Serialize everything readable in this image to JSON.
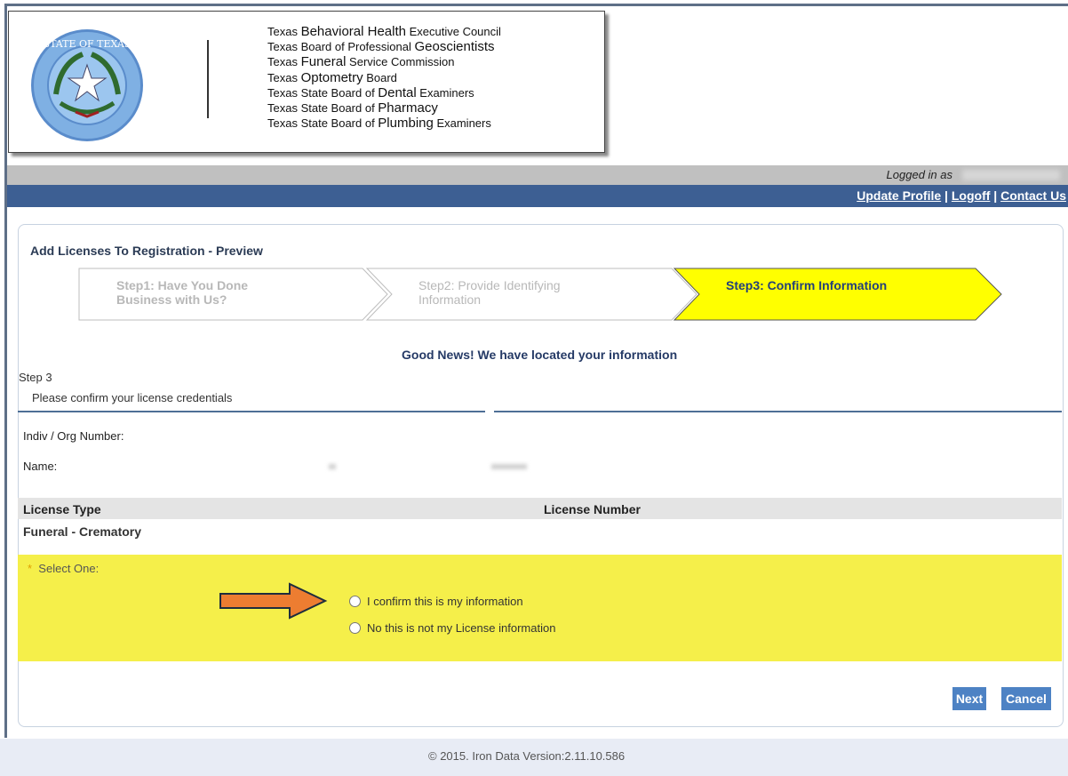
{
  "header": {
    "boards": [
      {
        "pre": "Texas ",
        "big": "Behavioral Health",
        "post": " Executive Council"
      },
      {
        "pre": "Texas Board of Professional ",
        "big": "Geoscientists",
        "post": ""
      },
      {
        "pre": "Texas ",
        "big": "Funeral",
        "post": " Service Commission"
      },
      {
        "pre": "Texas ",
        "big": "Optometry",
        "post": " Board"
      },
      {
        "pre": "Texas State Board of ",
        "big": "Dental",
        "post": " Examiners"
      },
      {
        "pre": "Texas State Board of ",
        "big": "Pharmacy",
        "post": ""
      },
      {
        "pre": "Texas State Board of ",
        "big": "Plumbing",
        "post": " Examiners"
      }
    ]
  },
  "topbar": {
    "logged_in_label": "Logged in as"
  },
  "nav": {
    "update_profile": "Update Profile",
    "logoff": "Logoff",
    "contact_us": "Contact Us",
    "separator": " | "
  },
  "page": {
    "title": "Add Licenses To Registration - Preview",
    "steps": [
      {
        "line1": "Step1: Have You Done",
        "line2": "Business with Us?"
      },
      {
        "line1": "Step2: Provide Identifying",
        "line2": "Information"
      },
      {
        "line1": "Step3: Confirm Information",
        "line2": ""
      }
    ],
    "good_news": "Good News! We have located your information",
    "step_label": "Step 3",
    "confirm_instruction": "Please confirm your license credentials",
    "indiv_org_label": "Indiv / Org Number:",
    "name_label": "Name:",
    "table": {
      "headers": [
        "License Type",
        "License Number"
      ],
      "rows": [
        [
          "Funeral - Crematory",
          ""
        ]
      ]
    },
    "select_one_label": "Select One:",
    "required_marker": "*",
    "options": [
      "I confirm this is my information",
      "No this is not my License information"
    ],
    "next_button": "Next",
    "cancel_button": "Cancel"
  },
  "footer": {
    "text": "© 2015. Iron Data Version:2.11.10.586"
  },
  "colors": {
    "nav_bar": "#3d5f93",
    "active_step": "#ffff00",
    "confirm_area": "#f5ef4a",
    "arrow": "#ed7d31",
    "button": "#4d82c4"
  }
}
